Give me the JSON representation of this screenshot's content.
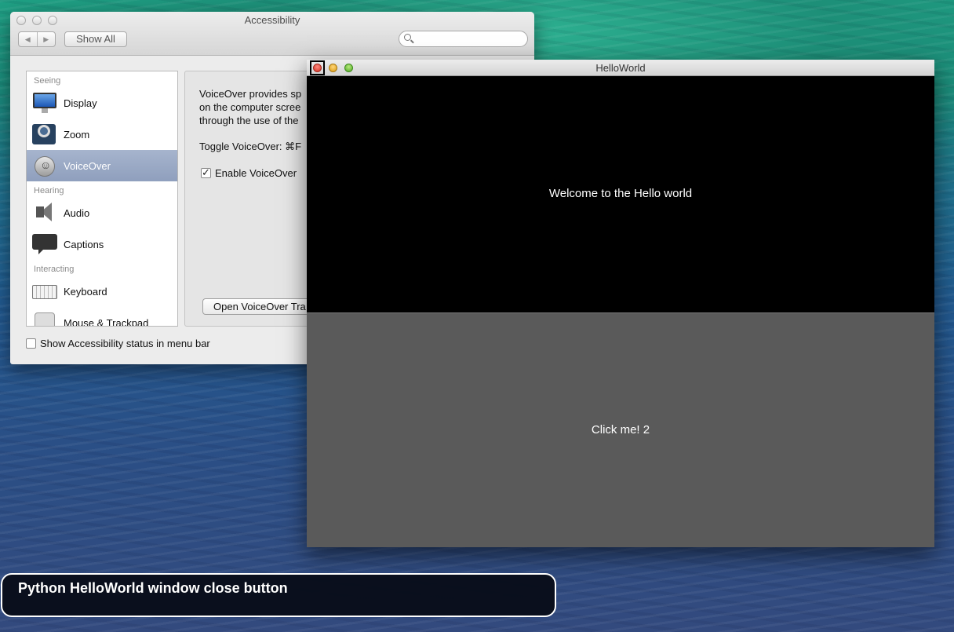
{
  "accessibility_window": {
    "title": "Accessibility",
    "nav": {
      "back": "◀",
      "forward": "▶"
    },
    "show_all_label": "Show All",
    "search": {
      "placeholder": ""
    },
    "sidebar": {
      "sections": [
        {
          "label": "Seeing",
          "items": [
            {
              "label": "Display",
              "icon": "display-icon"
            },
            {
              "label": "Zoom",
              "icon": "zoom-icon"
            },
            {
              "label": "VoiceOver",
              "icon": "voiceover-icon",
              "selected": true
            }
          ]
        },
        {
          "label": "Hearing",
          "items": [
            {
              "label": "Audio",
              "icon": "audio-icon"
            },
            {
              "label": "Captions",
              "icon": "captions-icon"
            }
          ]
        },
        {
          "label": "Interacting",
          "items": [
            {
              "label": "Keyboard",
              "icon": "keyboard-icon"
            },
            {
              "label": "Mouse & Trackpad",
              "icon": "mouse-icon"
            }
          ]
        }
      ]
    },
    "content": {
      "description_lines": [
        "VoiceOver provides sp",
        "on the computer scree",
        "through the use of the"
      ],
      "toggle_label": "Toggle VoiceOver:  ⌘F",
      "enable_label": "Enable VoiceOver",
      "enable_checked": true,
      "open_utility_label": "Open VoiceOver Tra"
    },
    "status_bar_label": "Show Accessibility status in menu bar",
    "status_bar_checked": false
  },
  "hello_world_window": {
    "title": "HelloWorld",
    "welcome_text": "Welcome to the Hello world",
    "button_label": "Click me! 2",
    "colors": {
      "top_bg": "#000000",
      "button_bg": "#5a5a5a"
    }
  },
  "voiceover_caption": {
    "text": "Python HelloWorld window close button"
  }
}
